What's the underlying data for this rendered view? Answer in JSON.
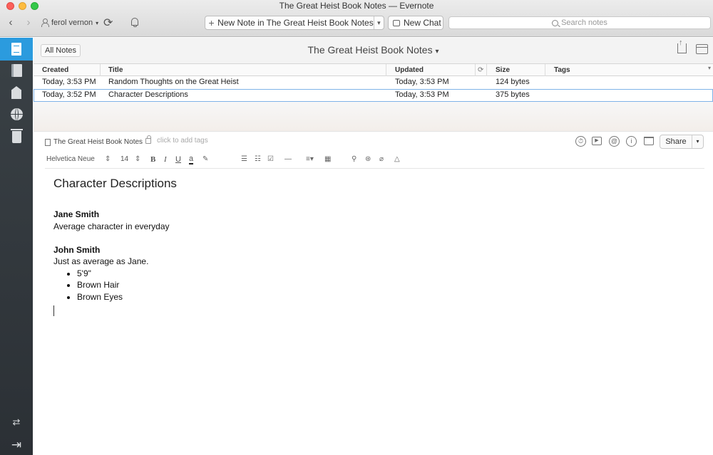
{
  "window": {
    "title": "The Great Heist Book Notes — Evernote"
  },
  "toolbar": {
    "back_icon": "chevron-left-icon",
    "forward_icon": "chevron-right-icon",
    "user_name": "ferol vernon",
    "new_note_label": "New Note in The Great Heist Book Notes",
    "new_chat_label": "New Chat",
    "search_placeholder": "Search notes"
  },
  "sidebar": {
    "items": [
      {
        "name": "notes",
        "icon": "note-icon",
        "active": true
      },
      {
        "name": "notebooks",
        "icon": "notebook-icon",
        "active": false
      },
      {
        "name": "tags",
        "icon": "tag-icon",
        "active": false
      },
      {
        "name": "shared",
        "icon": "globe-icon",
        "active": false
      },
      {
        "name": "trash",
        "icon": "trash-icon",
        "active": false
      }
    ]
  },
  "list": {
    "all_notes_label": "All Notes",
    "notebook_title": "The Great Heist Book Notes",
    "columns": [
      "Created",
      "Title",
      "Updated",
      "Size",
      "Tags"
    ],
    "rows": [
      {
        "created": "Today, 3:53 PM",
        "title": "Random Thoughts on the Great Heist",
        "updated": "Today, 3:53 PM",
        "size": "124 bytes",
        "tags": ""
      },
      {
        "created": "Today, 3:52 PM",
        "title": "Character Descriptions",
        "updated": "Today, 3:53 PM",
        "size": "375 bytes",
        "tags": ""
      }
    ]
  },
  "note": {
    "notebook": "The Great Heist Book Notes",
    "tags_placeholder": "click to add tags",
    "share_label": "Share",
    "font_name": "Helvetica Neue",
    "font_size": "14",
    "title": "Character Descriptions",
    "body": {
      "name1": "Jane Smith",
      "desc1": "Average character in everyday",
      "name2": "John Smith",
      "desc2": "Just as average as Jane.",
      "bullets": [
        "5'9\"",
        "Brown Hair",
        "Brown Eyes"
      ]
    }
  }
}
